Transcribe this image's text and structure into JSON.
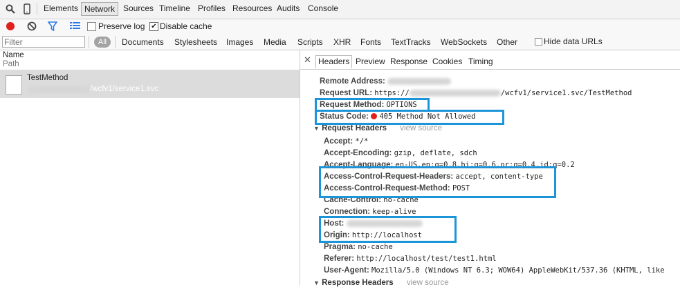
{
  "toolbar": {
    "tabs": [
      "Elements",
      "Network",
      "Sources",
      "Timeline",
      "Profiles",
      "Resources",
      "Audits",
      "Console"
    ]
  },
  "network_bar": {
    "preserve_log": "Preserve log",
    "disable_cache": "Disable cache"
  },
  "filter_bar": {
    "placeholder": "Filter",
    "all": "All",
    "types": [
      "Documents",
      "Stylesheets",
      "Images",
      "Media",
      "Scripts",
      "XHR",
      "Fonts",
      "TextTracks",
      "WebSockets",
      "Other"
    ],
    "hide_data_urls": "Hide data URLs"
  },
  "list": {
    "col_name": "Name",
    "col_path": "Path",
    "request_name": "TestMethod",
    "request_path": "/wcfv1/service1.svc"
  },
  "detail_tabs": [
    "Headers",
    "Preview",
    "Response",
    "Cookies",
    "Timing"
  ],
  "general": {
    "remote_address_label": "Remote Address:",
    "request_url_label": "Request URL:",
    "request_url_prefix": "https://",
    "request_url_suffix": "/wcfv1/service1.svc/TestMethod",
    "request_method_label": "Request Method:",
    "request_method_value": "OPTIONS",
    "status_code_label": "Status Code:",
    "status_code_value": "405 Method Not Allowed"
  },
  "request_headers": {
    "title": "Request Headers",
    "view_source": "view source",
    "accept_label": "Accept:",
    "accept_value": "*/*",
    "accept_encoding_label": "Accept-Encoding:",
    "accept_encoding_value": "gzip, deflate, sdch",
    "accept_language_label": "Accept-Language:",
    "accept_language_value": "en-US,en;q=0.8,hi;q=0.6,or;q=0.4,id;q=0.2",
    "acr_headers_label": "Access-Control-Request-Headers:",
    "acr_headers_value": "accept, content-type",
    "acr_method_label": "Access-Control-Request-Method:",
    "acr_method_value": "POST",
    "cache_control_label": "Cache-Control:",
    "cache_control_value": "no-cache",
    "connection_label": "Connection:",
    "connection_value": "keep-alive",
    "host_label": "Host:",
    "origin_label": "Origin:",
    "origin_value": "http://localhost",
    "pragma_label": "Pragma:",
    "pragma_value": "no-cache",
    "referer_label": "Referer:",
    "referer_value": "http://localhost/test/test1.html",
    "user_agent_label": "User-Agent:",
    "user_agent_value": "Mozilla/5.0 (Windows NT 6.3; WOW64) AppleWebKit/537.36 (KHTML, like"
  },
  "response_headers": {
    "title": "Response Headers",
    "view_source": "view source"
  },
  "colors": {
    "highlight": "#1c95d8",
    "status_red": "#e0201b",
    "selected_row": "#dcdcdc"
  }
}
